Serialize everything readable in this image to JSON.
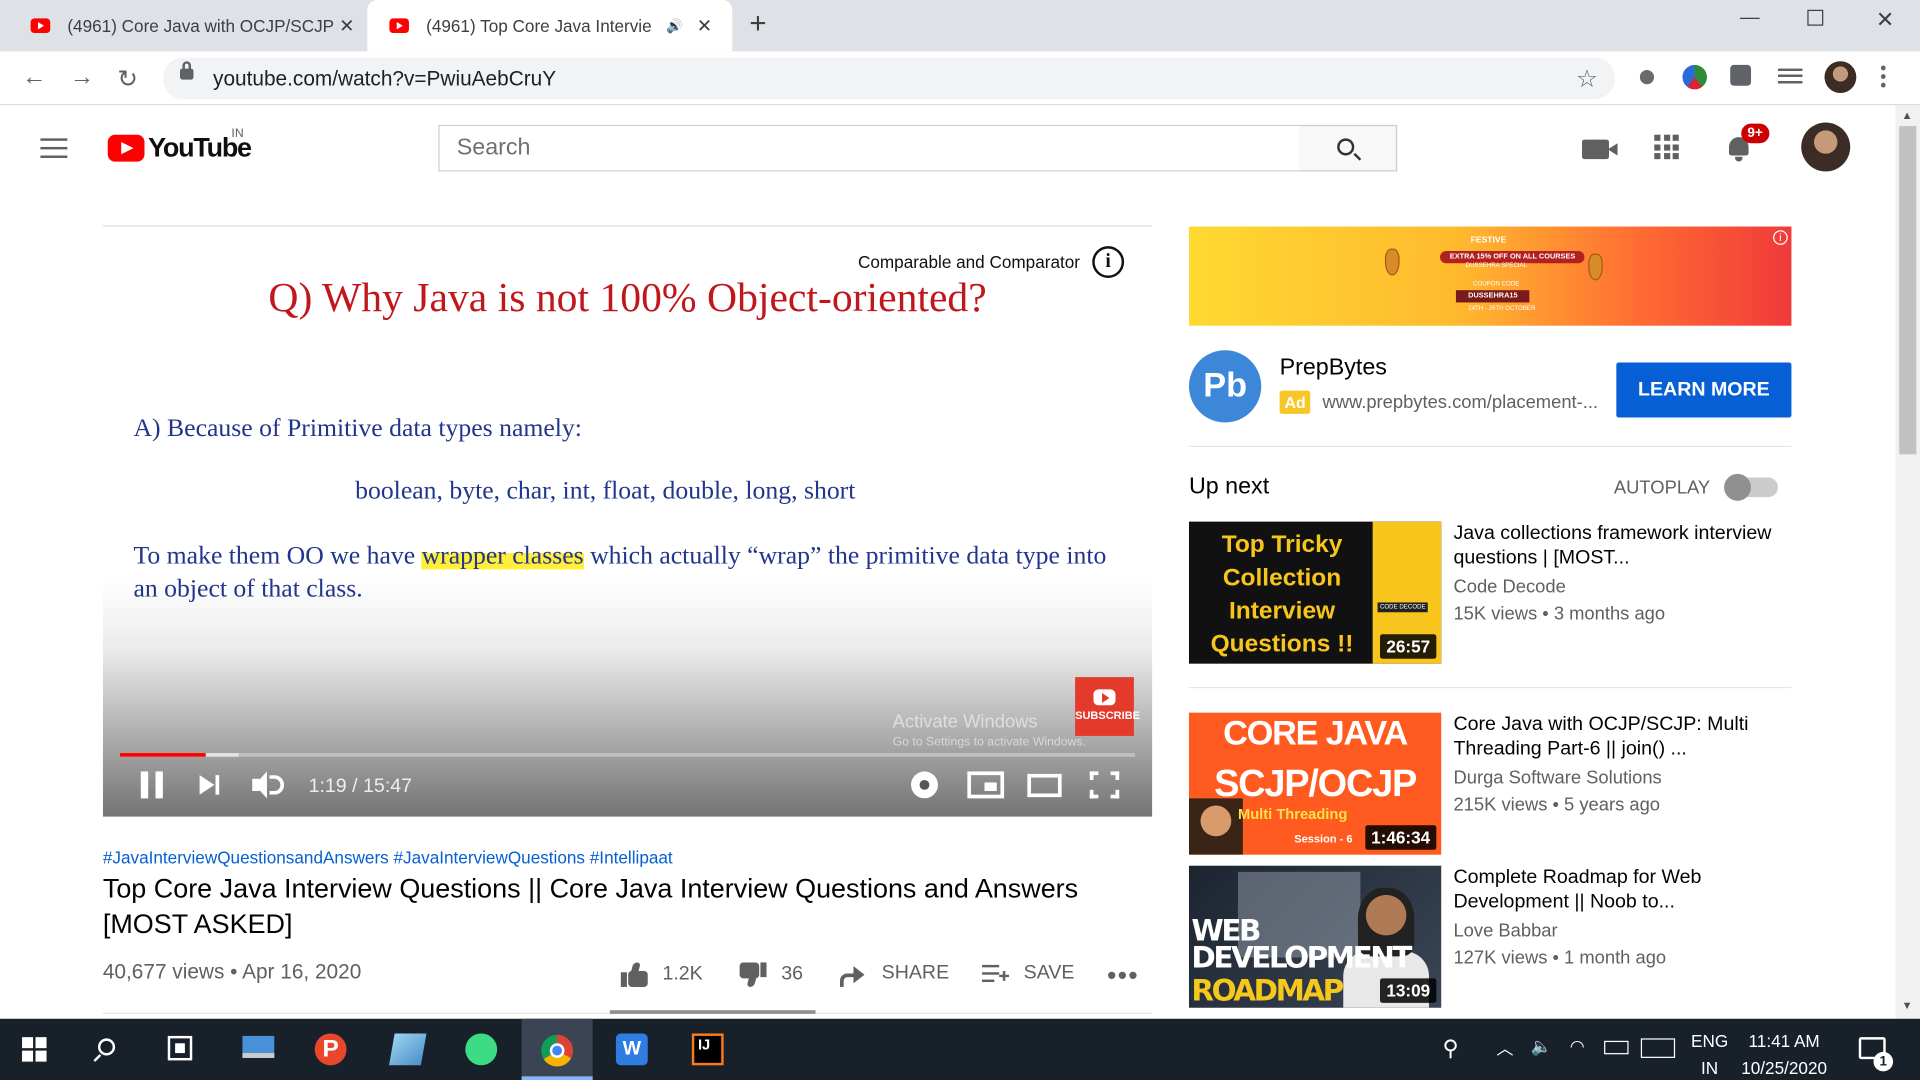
{
  "browser": {
    "tabs": [
      {
        "title": "(4961) Core Java with OCJP/SCJP",
        "active": false
      },
      {
        "title": "(4961) Top Core Java Intervie",
        "active": true
      }
    ],
    "url": "youtube.com/watch?v=PwiuAebCruY"
  },
  "youtube": {
    "logo_text": "YouTube",
    "region": "IN",
    "search_placeholder": "Search",
    "notification_count": "9+"
  },
  "player": {
    "slide_question": "Q) Why Java is not 100% Object-oriented?",
    "slide_answer": "A) Because of Primitive data types namely:",
    "slide_types": "boolean, byte, char, int, float, double, long, short",
    "slide_oo_1": "To make them OO we have",
    "slide_oo_hl": "wrapper classes",
    "slide_oo_2": "which actually “wrap” the primitive data type into an object of that class.",
    "card_title": "Comparable and Comparator",
    "card_info": "i",
    "watermark_title": "Activate Windows",
    "watermark_sub": "Go to Settings to activate Windows.",
    "subscribe_label": "SUBSCRIBE",
    "time": "1:19 / 15:47",
    "progress_played": 0.084,
    "progress_buffered": 0.117
  },
  "video": {
    "hashtags": "#JavaInterviewQuestionsandAnswers #JavaInterviewQuestions #Intellipaat",
    "title": "Top Core Java Interview Questions || Core Java Interview Questions and Answers [MOST ASKED]",
    "meta": "40,677 views • Apr 16, 2020",
    "likes": "1.2K",
    "dislikes": "36",
    "share_label": "SHARE",
    "save_label": "SAVE",
    "more_label": "•••"
  },
  "ad": {
    "banner": {
      "festive": "FESTIVE",
      "offer": "EXTRA 15% OFF ON ALL COURSES",
      "sub": "DUSSEHRA SPECIAL",
      "coupon": "COUPON CODE",
      "code": "DUSSEHRA15",
      "dates": "24TH - 26TH OCTOBER"
    },
    "logo_text": "Pb",
    "advertiser": "PrepBytes",
    "tag": "Ad",
    "url": "www.prepbytes.com/placement-...",
    "cta": "LEARN MORE"
  },
  "sidebar": {
    "up_next": "Up next",
    "autoplay": "AUTOPLAY",
    "autoplay_on": false,
    "recommendations": [
      {
        "title": "Java collections framework interview questions | [MOST...",
        "channel": "Code Decode",
        "stats": "15K views • 3 months ago",
        "duration": "26:57",
        "thumb_lines": [
          "Top Tricky",
          "Collection",
          "Interview",
          "Questions !!"
        ],
        "thumb_badge": "CODE DECODE"
      },
      {
        "title": "Core Java with OCJP/SCJP: Multi Threading Part-6 || join() ...",
        "channel": "Durga Software Solutions",
        "stats": "215K views • 5 years ago",
        "duration": "1:46:34",
        "thumb_lines": [
          "CORE JAVA",
          "SCJP/OCJP",
          "Multi Threading",
          "Session - 6"
        ]
      },
      {
        "title": "Complete Roadmap for Web Development || Noob to...",
        "channel": "Love Babbar",
        "stats": "127K views • 1 month ago",
        "duration": "13:09",
        "thumb_lines": [
          "WEB",
          "DEVELOPMENT",
          "ROADMAP"
        ]
      }
    ]
  },
  "taskbar": {
    "lang": "ENG",
    "region": "IN",
    "time": "11:41 AM",
    "date": "10/25/2020",
    "notifications": "1"
  }
}
